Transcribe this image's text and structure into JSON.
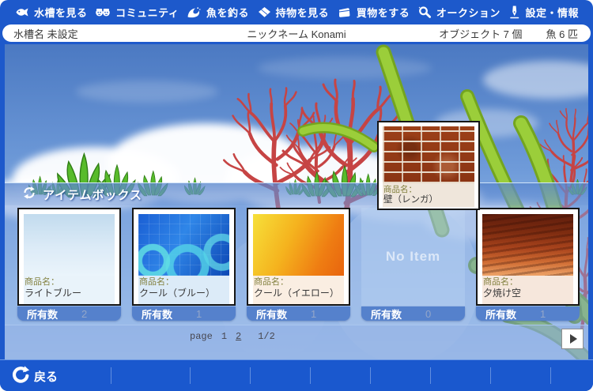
{
  "menu": {
    "items": [
      {
        "label": "水槽を見る",
        "icon": "fish-icon"
      },
      {
        "label": "コミュニティ",
        "icon": "community-icon"
      },
      {
        "label": "魚を釣る",
        "icon": "wave-icon"
      },
      {
        "label": "持物を見る",
        "icon": "package-icon"
      },
      {
        "label": "買物をする",
        "icon": "wallet-icon"
      },
      {
        "label": "オークション",
        "icon": "magnifier-icon"
      },
      {
        "label": "設定・情報",
        "icon": "pen-icon"
      }
    ]
  },
  "infobar": {
    "tank_name": "水槽名 未設定",
    "nickname": "ニックネーム Konami",
    "object_count": "オブジェクト 7 個",
    "fish_count": "魚 6 匹"
  },
  "floating_item": {
    "product_label": "商品名：",
    "name": "壁（レンガ）"
  },
  "item_box": {
    "title": "アイテムボックス",
    "product_label": "商品名：",
    "owned_label": "所有数",
    "no_item_text": "No Item",
    "items": [
      {
        "name": "ライトブルー",
        "count": "2",
        "empty": false
      },
      {
        "name": "クール（ブルー）",
        "count": "1",
        "empty": false
      },
      {
        "name": "クール（イエロー）",
        "count": "1",
        "empty": false
      },
      {
        "name": "",
        "count": "0",
        "empty": true
      },
      {
        "name": "夕焼け空",
        "count": "1",
        "empty": false
      }
    ]
  },
  "pager": {
    "label": "page",
    "page1": "1",
    "page2": "2",
    "current": "2",
    "fraction": "1/2"
  },
  "footer": {
    "back_label": "戻る"
  },
  "colors": {
    "menu_blue": "#1d59cb",
    "panel_blue": "#769ed9",
    "owned_bar_blue": "#5581cc",
    "coral_red": "#c64444",
    "leaf_green": "#9bce3a"
  }
}
